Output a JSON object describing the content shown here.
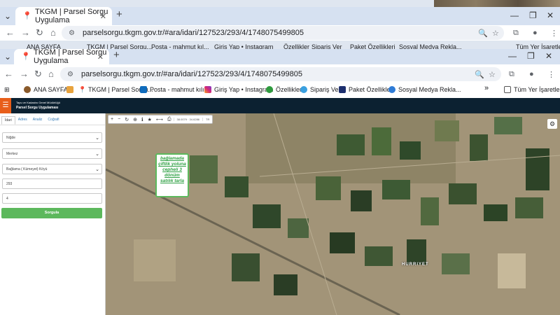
{
  "back_window": {
    "tab_title": "TKGM | Parsel Sorgu Uygulama",
    "url": "parselsorgu.tkgm.gov.tr/#ara/idari/127523/293/4/1748075499805",
    "bookmarks": [
      "ANA SAYFA",
      "TKGM | Parsel Sorgu...",
      "Posta - mahmut kıl...",
      "Giriş Yap • Instagram",
      "Özellikler",
      "Sipariş Ver",
      "Paket Özellikleri",
      "Sosyal Medya Rekla...",
      "Tüm Yer İşaretleri"
    ]
  },
  "front_window": {
    "tab_title": "TKGM | Parsel Sorgu Uygulama",
    "url": "parselsorgu.tkgm.gov.tr/#ara/idari/127523/293/4/1748075499805",
    "new_tab": "+",
    "bookmarks": {
      "ana_sayfa": "ANA SAYFA",
      "tkgm": "TKGM | Parsel Sorgu...",
      "posta": "Posta - mahmut kılı...",
      "instagram": "Giriş Yap • Instagram",
      "ozellikler": "Özellikler",
      "siparis": "Sipariş Ver",
      "paket": "Paket Özellikleri",
      "sosyal": "Sosyal Medya Rekla...",
      "more": "»",
      "tum": "Tüm Yer İşaretleri"
    }
  },
  "app": {
    "agency": "Tapu ve Kadastro Genel Müdürlüğü",
    "app_name": "Parsel Sorgu Uygulaması",
    "tabs": [
      "İdari",
      "Adres",
      "Analiz",
      "Coğrafi"
    ],
    "fields": {
      "il": "Niğde",
      "ilce": "Merkez",
      "mahalle": "Bağlama ( Kümeyet) Köyü",
      "ada": "293",
      "parsel": "4"
    },
    "query_button": "Sorgula",
    "map_coord": "38.0079 · 34.6286",
    "map_scale": "TR",
    "ad_text": [
      "bağlamada",
      "çiftlik yoluna",
      "cepheli 3",
      "dönüm",
      "satılık  tarla"
    ],
    "place_label": "HURRIYET"
  },
  "colors": {
    "header_bg": "#0c2131",
    "accent_orange": "#e85e1a",
    "query_green": "#5cb85c",
    "ad_text_green": "#2ea043"
  }
}
